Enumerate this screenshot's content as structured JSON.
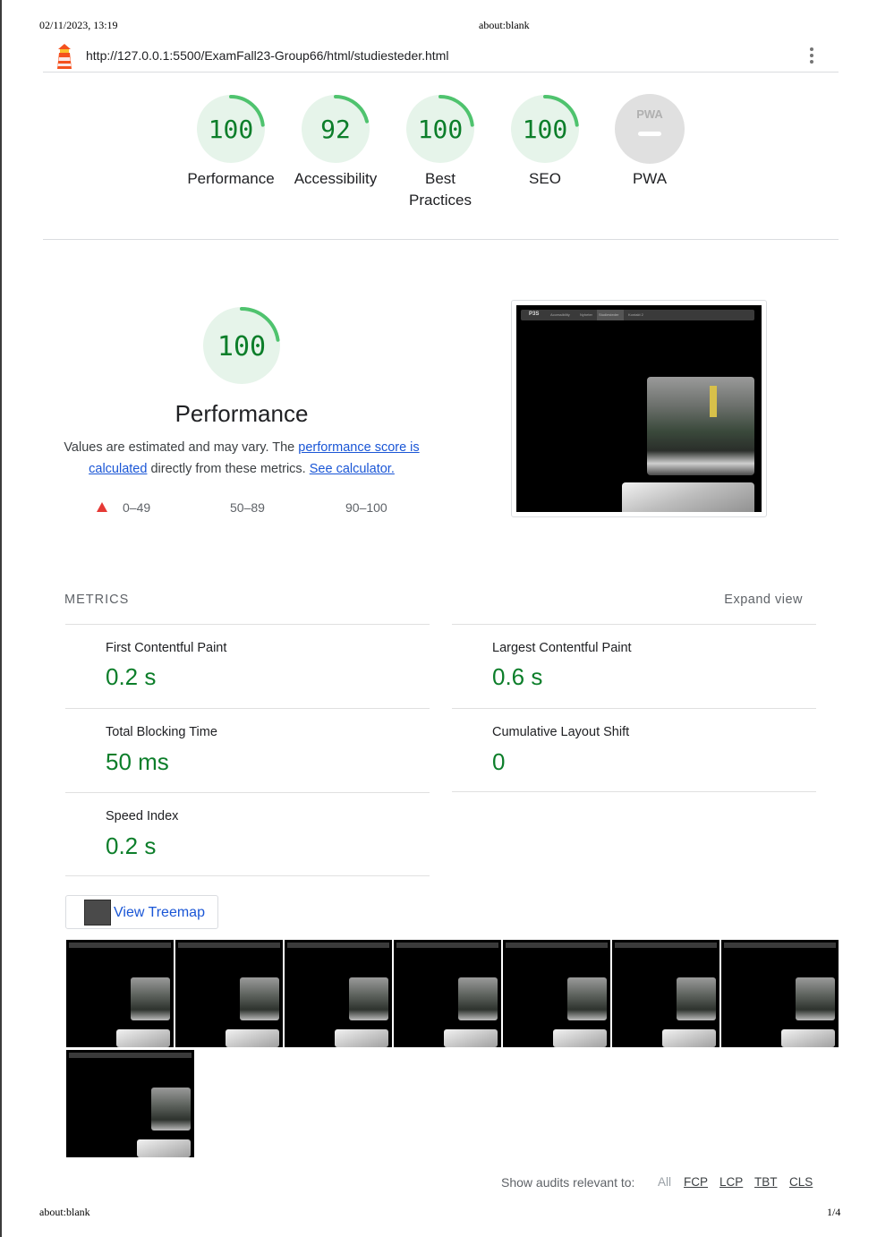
{
  "print_header": {
    "datetime": "02/11/2023, 13:19",
    "title": "about:blank"
  },
  "print_footer": {
    "left": "about:blank",
    "page": "1/4"
  },
  "topbar": {
    "url": "http://127.0.0.1:5500/ExamFall23-Group66/html/studiesteder.html",
    "logo_icon": "lighthouse-icon",
    "menu_icon": "kebab-menu-icon"
  },
  "colors": {
    "pass": "#0c7e2a",
    "pass_arc": "#4fc36e",
    "pass_bg": "#e6f4ea",
    "fail": "#e53935",
    "link": "#1a56d6",
    "pwa_bg": "#e0e0e0"
  },
  "gauges": [
    {
      "score": "100",
      "label": "Performance",
      "value": 1.0
    },
    {
      "score": "92",
      "label": "Accessibility",
      "value": 0.92
    },
    {
      "score": "100",
      "label": "Best Practices",
      "value": 1.0
    },
    {
      "score": "100",
      "label": "SEO",
      "value": 1.0
    },
    {
      "score": "",
      "label": "PWA",
      "badge": "PWA"
    }
  ],
  "performance": {
    "score": "100",
    "title": "Performance",
    "desc_prefix": "Values are estimated and may vary. The ",
    "desc_link1": "performance score is calculated",
    "desc_middle": " directly from these metrics. ",
    "desc_link2": "See calculator.",
    "legend": [
      "0–49",
      "50–89",
      "90–100"
    ]
  },
  "screenshot": {
    "nav_logo": "P3S",
    "nav_items": [
      "Accessibility",
      "Nyheter",
      "Studiesteder",
      "Kontakt 2"
    ]
  },
  "metrics": {
    "heading": "METRICS",
    "expand": "Expand view",
    "items": [
      {
        "name": "First Contentful Paint",
        "value": "0.2 s"
      },
      {
        "name": "Largest Contentful Paint",
        "value": "0.6 s"
      },
      {
        "name": "Total Blocking Time",
        "value": "50 ms"
      },
      {
        "name": "Cumulative Layout Shift",
        "value": "0"
      },
      {
        "name": "Speed Index",
        "value": "0.2 s"
      }
    ]
  },
  "treemap": {
    "label": "View Treemap",
    "icon": "treemap-icon"
  },
  "filmstrip_count": 8,
  "filter": {
    "label": "Show audits relevant to:",
    "options": [
      "All",
      "FCP",
      "LCP",
      "TBT",
      "CLS"
    ]
  }
}
